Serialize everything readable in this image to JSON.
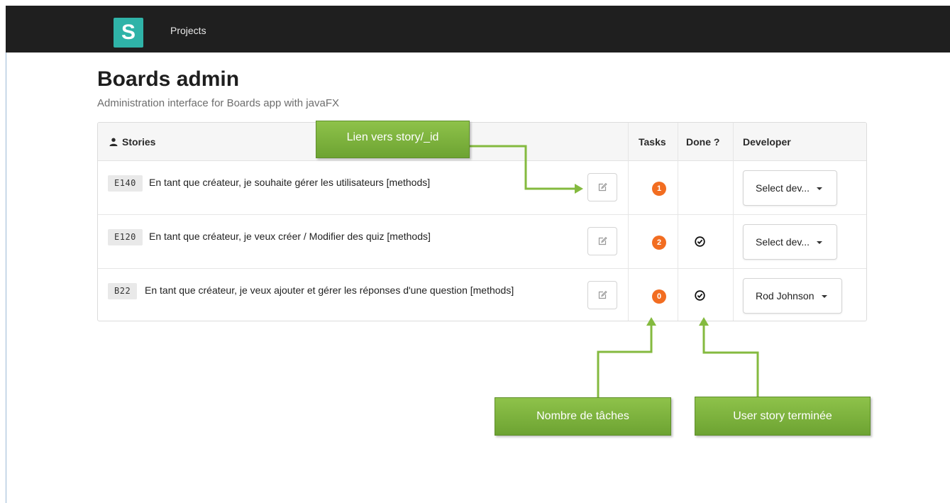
{
  "navbar": {
    "logo_letter": "S",
    "links": [
      "Projects"
    ]
  },
  "page": {
    "title": "Boards admin",
    "subtitle": "Administration interface for Boards app with javaFX"
  },
  "table": {
    "headers": {
      "stories": "Stories",
      "tasks": "Tasks",
      "done": "Done ?",
      "developer": "Developer"
    },
    "rows": [
      {
        "code": "E140",
        "text": "En tant que créateur, je souhaite gérer les utilisateurs [methods]",
        "tasks": "1",
        "done": false,
        "developer": "Select dev..."
      },
      {
        "code": "E120",
        "text": "En tant que créateur, je veux créer / Modifier des quiz [methods]",
        "tasks": "2",
        "done": true,
        "developer": "Select dev..."
      },
      {
        "code": "B22",
        "text": "En tant que créateur, je veux ajouter et gérer les réponses d'une question [methods]",
        "tasks": "0",
        "done": true,
        "developer": "Rod Johnson"
      }
    ]
  },
  "annotations": {
    "story_link": "Lien vers story/_id",
    "task_count": "Nombre de tâches",
    "story_done": "User story terminée"
  },
  "colors": {
    "navbar": "#1f1f1f",
    "logo": "#2fb3a8",
    "task_badge": "#f26d21",
    "callout": "#7db33c"
  },
  "icons": {
    "stories_header": "user-icon",
    "edit": "edit-icon",
    "done": "check-circle-icon",
    "dropdown": "caret-down-icon"
  }
}
